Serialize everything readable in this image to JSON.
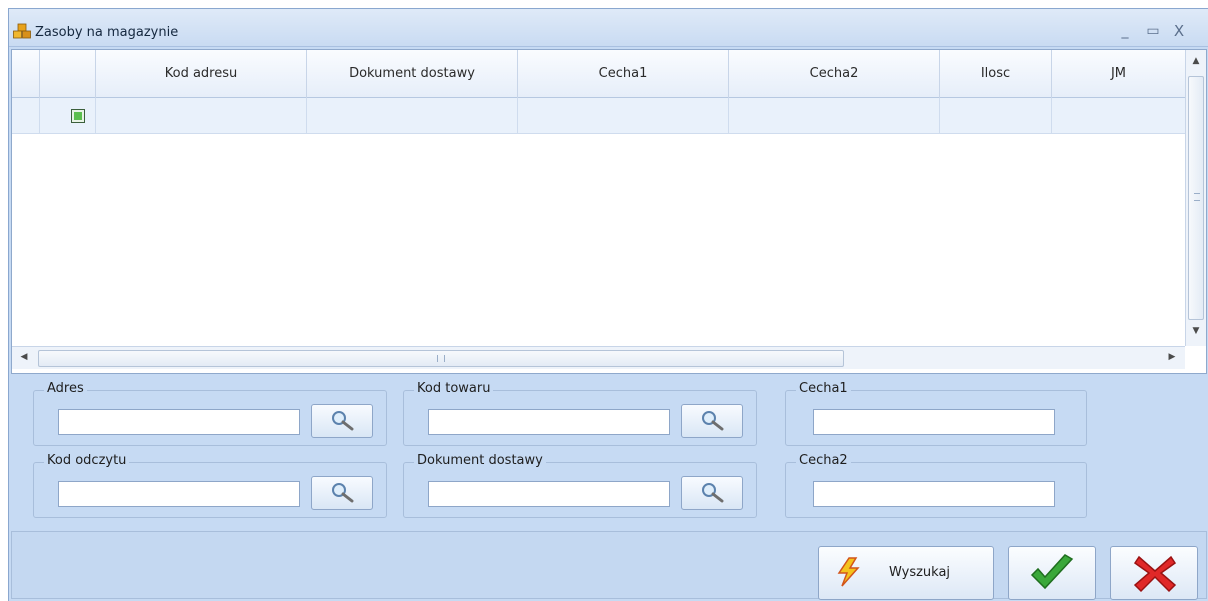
{
  "window": {
    "title": "Zasoby na magazynie",
    "minimize_glyph": "_",
    "maximize_glyph": "▭",
    "close_glyph": "X"
  },
  "grid": {
    "columns": [
      "",
      "",
      "Kod adresu",
      "Dokument dostawy",
      "Cecha1",
      "Cecha2",
      "Ilosc",
      "JM"
    ],
    "rows": [
      {
        "checked": true,
        "cells": [
          "",
          "",
          "",
          "",
          "",
          ""
        ]
      }
    ],
    "h_scroll_grip": "III"
  },
  "filters": {
    "adres": {
      "label": "Adres",
      "value": ""
    },
    "kod_towaru": {
      "label": "Kod towaru",
      "value": ""
    },
    "cecha1": {
      "label": "Cecha1",
      "value": ""
    },
    "kod_odczytu": {
      "label": "Kod odczytu",
      "value": ""
    },
    "dokument_dostawy": {
      "label": "Dokument dostawy",
      "value": ""
    },
    "cecha2": {
      "label": "Cecha2",
      "value": ""
    }
  },
  "actions": {
    "search_label": "Wyszukaj"
  },
  "icons": {
    "app": "warehouse-boxes-icon",
    "search": "magnifier-icon",
    "search_action": "lightning-icon",
    "ok": "checkmark-icon",
    "cancel": "red-x-icon"
  },
  "colors": {
    "window_bg": "#c6daf3",
    "row_selected": "#e9f1fb",
    "ok_green": "#2f9e2f",
    "cancel_red": "#d92020"
  }
}
